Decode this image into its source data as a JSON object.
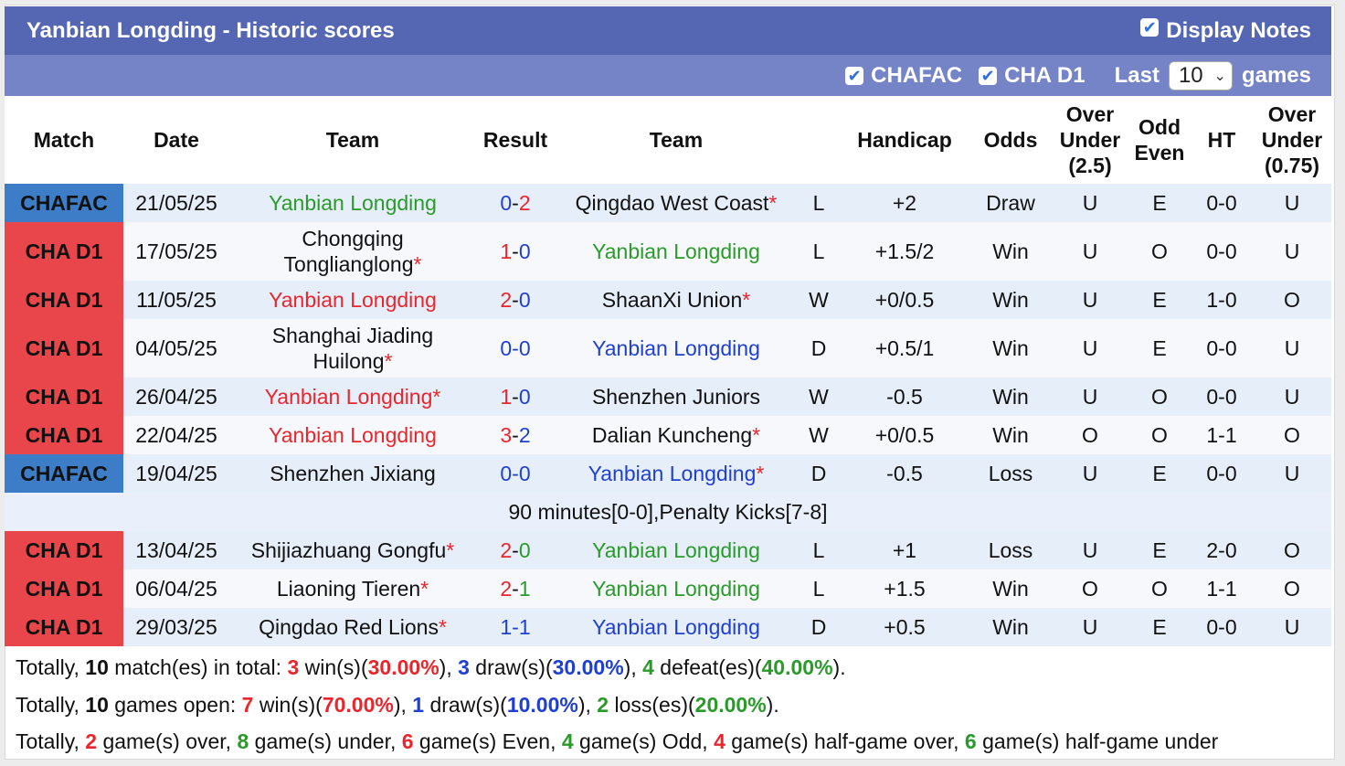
{
  "header": {
    "title": "Yanbian Longding - Historic scores",
    "display_notes_label": "Display Notes"
  },
  "filters": {
    "chafac_label": "CHAFAC",
    "chad1_label": "CHA D1",
    "last_label": "Last",
    "games_count": "10",
    "games_label": "games"
  },
  "columns": {
    "match": "Match",
    "date": "Date",
    "team_home": "Team",
    "result": "Result",
    "team_away": "Team",
    "handicap": "Handicap",
    "odds": "Odds",
    "over_under_l1": "Over",
    "over_under_l2": "Under",
    "over_under_l3": "(2.5)",
    "odd_even_l1": "Odd",
    "odd_even_l2": "Even",
    "ht": "HT",
    "ou2_l1": "Over",
    "ou2_l2": "Under",
    "ou2_l3": "(0.75)"
  },
  "rows": [
    {
      "league": "CHAFAC",
      "date": "21/05/25",
      "home": "Yanbian Longding",
      "home_star": false,
      "score_h": "0",
      "score_a": "2",
      "away": "Qingdao West Coast",
      "away_star": true,
      "wl": "L",
      "handicap": "+2",
      "odds": "Draw",
      "ou": "U",
      "oe": "E",
      "ht": "0-0",
      "ou2": "U"
    },
    {
      "league": "CHA D1",
      "date": "17/05/25",
      "home_l1": "Chongqing",
      "home_l2": "Tonglianglong",
      "home_star": true,
      "score_h": "1",
      "score_a": "0",
      "away": "Yanbian Longding",
      "away_star": false,
      "wl": "L",
      "handicap": "+1.5/2",
      "odds": "Win",
      "ou": "U",
      "oe": "O",
      "ht": "0-0",
      "ou2": "U"
    },
    {
      "league": "CHA D1",
      "date": "11/05/25",
      "home": "Yanbian Longding",
      "home_star": false,
      "score_h": "2",
      "score_a": "0",
      "away": "ShaanXi Union",
      "away_star": true,
      "wl": "W",
      "handicap": "+0/0.5",
      "odds": "Win",
      "ou": "U",
      "oe": "E",
      "ht": "1-0",
      "ou2": "O"
    },
    {
      "league": "CHA D1",
      "date": "04/05/25",
      "home_l1": "Shanghai Jiading",
      "home_l2": "Huilong",
      "home_star": true,
      "score_h": "0",
      "score_a": "0",
      "away": "Yanbian Longding",
      "away_star": false,
      "wl": "D",
      "handicap": "+0.5/1",
      "odds": "Win",
      "ou": "U",
      "oe": "E",
      "ht": "0-0",
      "ou2": "U"
    },
    {
      "league": "CHA D1",
      "date": "26/04/25",
      "home": "Yanbian Longding",
      "home_star": true,
      "score_h": "1",
      "score_a": "0",
      "away": "Shenzhen Juniors",
      "away_star": false,
      "wl": "W",
      "handicap": "-0.5",
      "odds": "Win",
      "ou": "U",
      "oe": "O",
      "ht": "0-0",
      "ou2": "U"
    },
    {
      "league": "CHA D1",
      "date": "22/04/25",
      "home": "Yanbian Longding",
      "home_star": false,
      "score_h": "3",
      "score_a": "2",
      "away": "Dalian Kuncheng",
      "away_star": true,
      "wl": "W",
      "handicap": "+0/0.5",
      "odds": "Win",
      "ou": "O",
      "oe": "O",
      "ht": "1-1",
      "ou2": "O"
    },
    {
      "league": "CHAFAC",
      "date": "19/04/25",
      "home": "Shenzhen Jixiang",
      "home_star": false,
      "score_h": "0",
      "score_a": "0",
      "away": "Yanbian Longding",
      "away_star": true,
      "wl": "D",
      "handicap": "-0.5",
      "odds": "Loss",
      "ou": "U",
      "oe": "E",
      "ht": "0-0",
      "ou2": "U"
    },
    {
      "league": "CHA D1",
      "date": "13/04/25",
      "home": "Shijiazhuang Gongfu",
      "home_star": true,
      "score_h": "2",
      "score_a": "0",
      "away": "Yanbian Longding",
      "away_star": false,
      "wl": "L",
      "handicap": "+1",
      "odds": "Loss",
      "ou": "U",
      "oe": "E",
      "ht": "2-0",
      "ou2": "O"
    },
    {
      "league": "CHA D1",
      "date": "06/04/25",
      "home": "Liaoning Tieren",
      "home_star": true,
      "score_h": "2",
      "score_a": "1",
      "away": "Yanbian Longding",
      "away_star": false,
      "wl": "L",
      "handicap": "+1.5",
      "odds": "Win",
      "ou": "O",
      "oe": "O",
      "ht": "1-1",
      "ou2": "O"
    },
    {
      "league": "CHA D1",
      "date": "29/03/25",
      "home": "Qingdao Red Lions",
      "home_star": true,
      "score_h": "1",
      "score_a": "1",
      "away": "Yanbian Longding",
      "away_star": false,
      "wl": "D",
      "handicap": "+0.5",
      "odds": "Win",
      "ou": "U",
      "oe": "E",
      "ht": "0-0",
      "ou2": "U"
    }
  ],
  "note_row": "90 minutes[0-0],Penalty Kicks[7-8]",
  "summary": {
    "l1": {
      "p1": "Totally, ",
      "n1": "10",
      "p2": " match(es) in total: ",
      "w": "3",
      "p3": " win(s)(",
      "wp": "30.00%",
      "p4": "), ",
      "d": "3",
      "p5": " draw(s)(",
      "dp": "30.00%",
      "p6": "), ",
      "l": "4",
      "p7": " defeat(es)(",
      "lp": "40.00%",
      "p8": ")."
    },
    "l2": {
      "p1": "Totally, ",
      "n1": "10",
      "p2": " games open: ",
      "w": "7",
      "p3": " win(s)(",
      "wp": "70.00%",
      "p4": "), ",
      "d": "1",
      "p5": " draw(s)(",
      "dp": "10.00%",
      "p6": "), ",
      "l": "2",
      "p7": " loss(es)(",
      "lp": "20.00%",
      "p8": ")."
    },
    "l3": {
      "p1": "Totally, ",
      "over": "2",
      "p2": " game(s) over, ",
      "under": "8",
      "p3": " game(s) under, ",
      "even": "6",
      "p4": " game(s) Even, ",
      "odd": "4",
      "p5": " game(s) Odd, ",
      "hgo": "4",
      "p6": " game(s) half-game over, ",
      "hgu": "6",
      "p7": " game(s) half-game under"
    }
  },
  "colors": {
    "title_bg": "#5567b2",
    "filter_bg": "#7584c7",
    "chafac": "#3d7cc6",
    "chad1": "#e8464a",
    "win": "#e8262c",
    "draw": "#1f3fcf",
    "loss": "#2a9a2a"
  }
}
